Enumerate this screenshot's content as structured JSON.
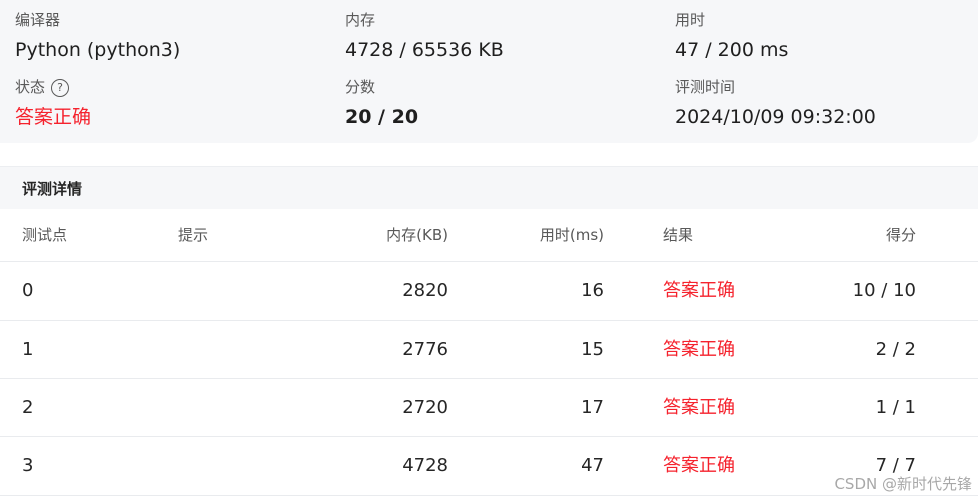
{
  "summary": {
    "compiler": {
      "label": "编译器",
      "value": "Python (python3)"
    },
    "memory": {
      "label": "内存",
      "value": "4728 / 65536 KB"
    },
    "time": {
      "label": "用时",
      "value": "47 / 200 ms"
    },
    "status": {
      "label": "状态",
      "help": "?",
      "value": "答案正确"
    },
    "score": {
      "label": "分数",
      "value": "20 / 20"
    },
    "judge_time": {
      "label": "评测时间",
      "value": "2024/10/09 09:32:00"
    }
  },
  "details": {
    "title": "评测详情",
    "columns": {
      "id": "测试点",
      "hint": "提示",
      "memory": "内存(KB)",
      "time": "用时(ms)",
      "result": "结果",
      "score": "得分"
    },
    "rows": [
      {
        "id": "0",
        "hint": "",
        "memory": "2820",
        "time": "16",
        "result": "答案正确",
        "score": "10 / 10"
      },
      {
        "id": "1",
        "hint": "",
        "memory": "2776",
        "time": "15",
        "result": "答案正确",
        "score": "2 / 2"
      },
      {
        "id": "2",
        "hint": "",
        "memory": "2720",
        "time": "17",
        "result": "答案正确",
        "score": "1 / 1"
      },
      {
        "id": "3",
        "hint": "",
        "memory": "4728",
        "time": "47",
        "result": "答案正确",
        "score": "7 / 7"
      }
    ]
  },
  "watermark": "CSDN @新时代先锋",
  "colors": {
    "accent_red": "#f5222d",
    "panel_bg": "#f6f7f9"
  }
}
